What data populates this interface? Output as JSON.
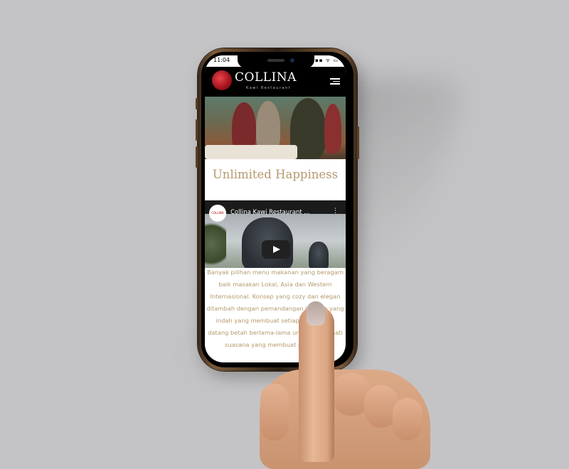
{
  "status_bar": {
    "time": "11:04",
    "icons": "▪▪▪ ᯤ ▭"
  },
  "header": {
    "brand": "COLLINA",
    "subtitle": "Kawi Restaurant"
  },
  "main": {
    "heading": "Unlimited Happiness",
    "video": {
      "channel_logo_text": "COLLINA",
      "title": "Collina Kawi Restaurant ...",
      "more": "⋮"
    },
    "body_text": "Banyak pilihan menu makanan yang beragam baik masakan Lokal, Asia dan Western Internasional. Konsep yang cozy dan elegan ditambah dengan pemandangan lembah yang indah yang membuat setiap orang yang datang betah berlama-lama untuk menikmati suasana yang membuat anda dan"
  },
  "colors": {
    "background": "#c4c4c6",
    "accent_gold": "#b39a6e",
    "header_bg": "#000000",
    "logo_red": "#a0121c"
  }
}
